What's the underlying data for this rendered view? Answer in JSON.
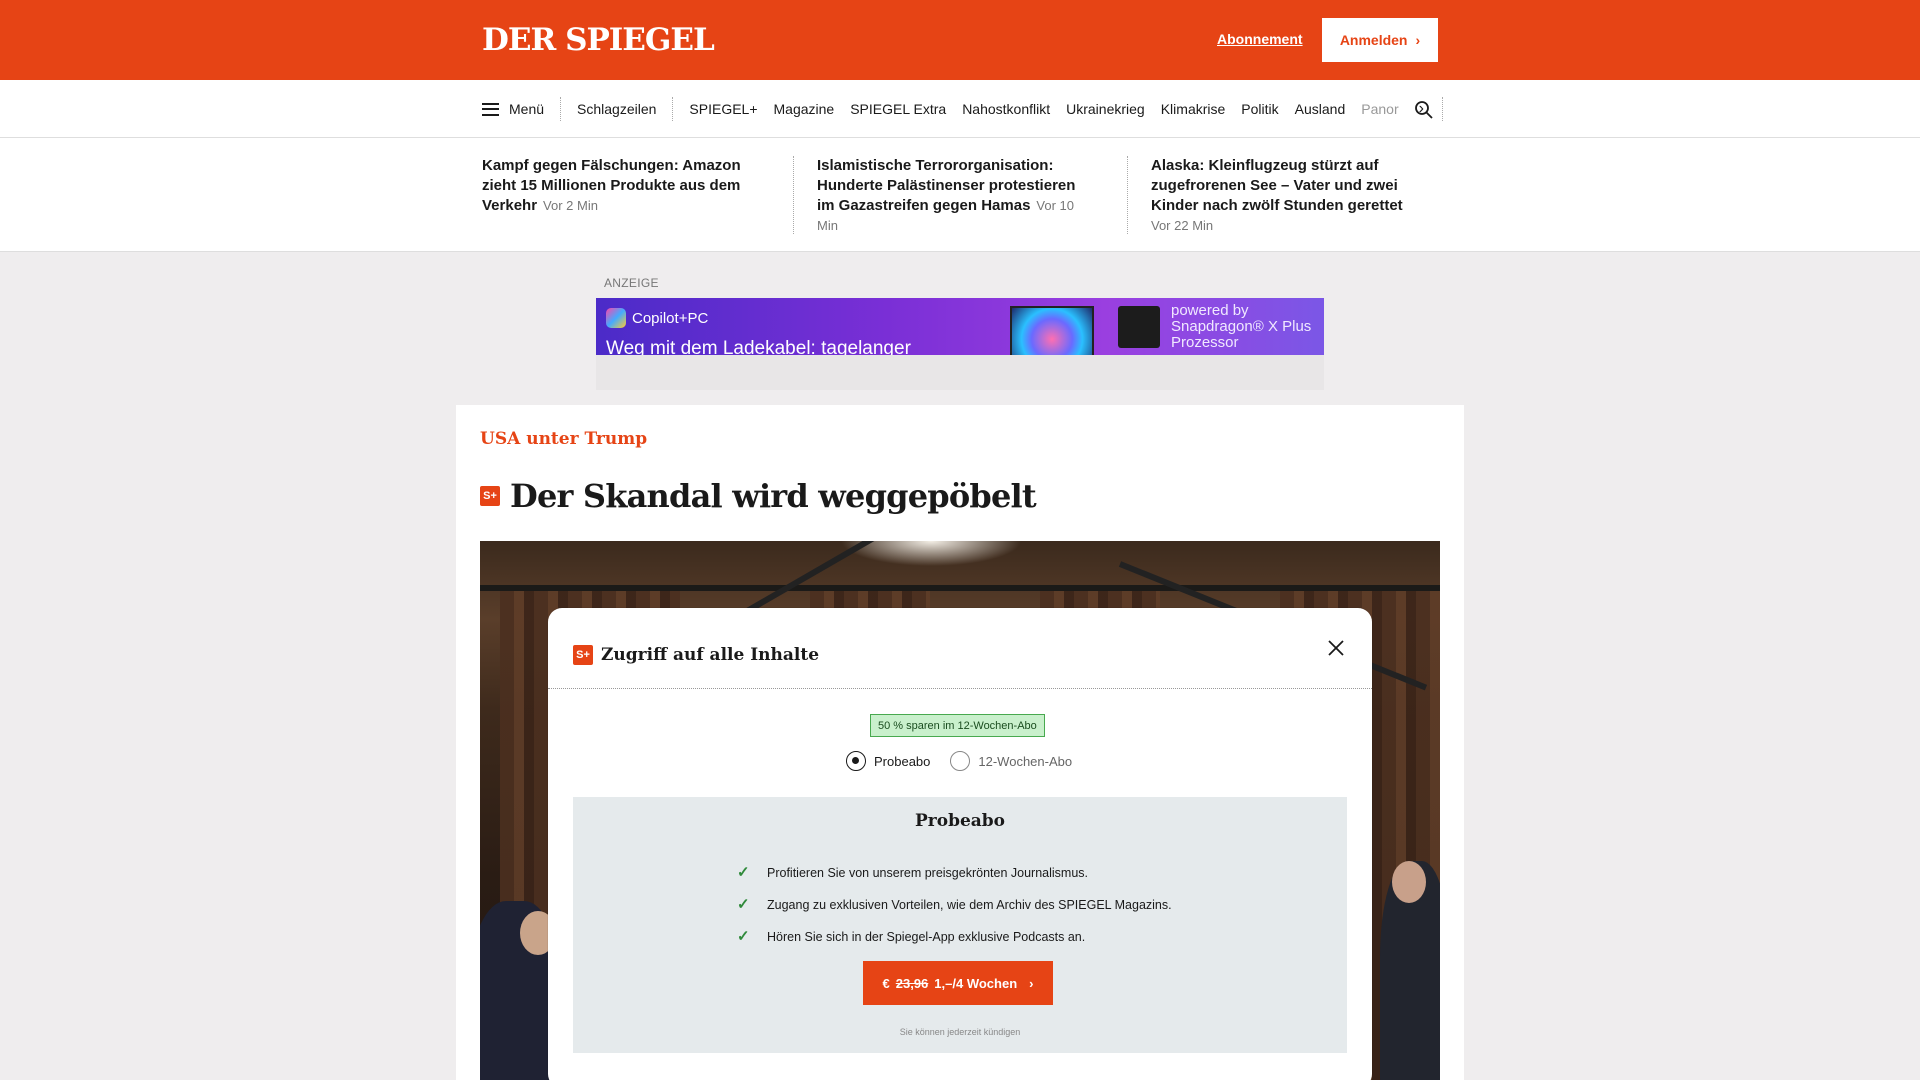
{
  "header": {
    "logo": "DER SPIEGEL",
    "subscription_link": "Abonnement",
    "login_button": "Anmelden",
    "brand_color": "#e64415"
  },
  "nav": {
    "menu_label": "Menü",
    "items": [
      "Schlagzeilen",
      "SPIEGEL+",
      "Magazine",
      "SPIEGEL Extra",
      "Nahostkonflikt",
      "Ukrainekrieg",
      "Klimakrise",
      "Politik",
      "Ausland"
    ],
    "truncated_item": "Panor",
    "more_icon": "chevron-right-icon",
    "search_icon": "search-icon"
  },
  "teasers": [
    {
      "title": "Kampf gegen Fälschungen: Amazon zieht 15 Millionen Produkte aus dem Verkehr",
      "time": "Vor 2 Min"
    },
    {
      "title": "Islamistische Terrororganisation: Hunderte Palästinenser protestieren im Gazastreifen gegen Hamas",
      "time": "Vor 10 Min"
    },
    {
      "title": "Alaska: Kleinflugzeug stürzt auf zugefrorenen See – Vater und zwei Kinder nach zwölf Stunden gerettet",
      "time": "Vor 22 Min"
    }
  ],
  "ad": {
    "label": "ANZEIGE",
    "brand": "Copilot+PC",
    "headline": "Weg mit dem Ladekabel: tagelanger",
    "powered_by": "powered by Snapdragon® X Plus Prozessor"
  },
  "article": {
    "kicker": "USA unter Trump",
    "headline": "Der Skandal wird weggepöbelt",
    "plus_badge": "S+"
  },
  "paywall": {
    "title": "Zugriff auf alle Inhalte",
    "badge": "S+",
    "save_badge": "50 % sparen im 12-Wochen-Abo",
    "options": [
      {
        "label": "Probeabo",
        "selected": true
      },
      {
        "label": "12-Wochen-Abo",
        "selected": false
      }
    ],
    "plan_title": "Probeabo",
    "benefits": [
      "Profitieren Sie von unserem preisgekrönten Journalismus.",
      "Zugang zu exklusiven Vorteilen, wie dem Archiv des SPIEGEL Magazins.",
      "Hören Sie sich in der Spiegel-App exklusive Podcasts an."
    ],
    "cta_currency": "€",
    "cta_old_price": "23,96",
    "cta_new_price": "1,–/4 Wochen",
    "cancel_note": "Sie können jederzeit kündigen"
  }
}
